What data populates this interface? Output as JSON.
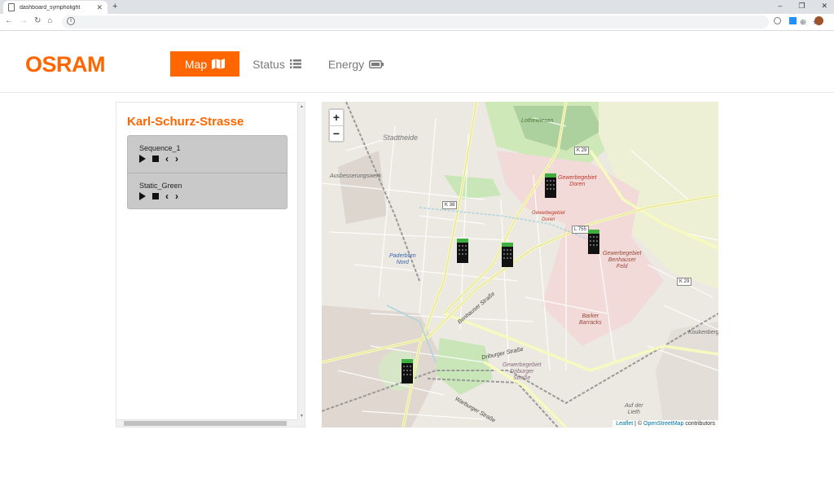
{
  "browser": {
    "tab_title": "dashboard_sympholight",
    "new_tab": "+",
    "win_min": "–",
    "win_max": "❐",
    "win_close": "✕"
  },
  "header": {
    "logo": "OSRAM",
    "menu": [
      {
        "label": "Map",
        "active": true
      },
      {
        "label": "Status",
        "active": false
      },
      {
        "label": "Energy",
        "active": false
      }
    ]
  },
  "panel": {
    "title": "Karl-Schurz-Strasse",
    "sequences": [
      {
        "name": "Sequence_1"
      },
      {
        "name": "Static_Green"
      }
    ]
  },
  "map": {
    "zoom_in": "+",
    "zoom_out": "−",
    "attribution_leaflet": "Leaflet",
    "attribution_sep": " | © ",
    "attribution_osm": "OpenStreetMap",
    "attribution_tail": " contributors",
    "labels": {
      "stadtheide": "Stadtheide",
      "lothewiesen": "Lothewiesen",
      "ausbesserungswerk": "Ausbesserungswerk",
      "gewerbegebiet_doren": "Gewerbegebiet\nDoren",
      "gewerbegebiet_doren_small": "Gewerbegebiet\nDoren",
      "gewerbegebiet_benhausen": "Gewerbegebiet\nBenhauser\nFeld",
      "paderborn_nord": "Paderborn\nNord",
      "barker": "Barker\nBarracks",
      "gewerbegebiet_driburger": "Gewerbegebiet\nDriburger\nStraße",
      "auf_der_lieth": "Auf der\nLieth",
      "benhauser_strasse": "Benhauser Straße",
      "driburger_strasse": "Driburger Straße",
      "warburger_strasse": "Warburger Straße",
      "koukenberg": "Koukenberg"
    },
    "roads": {
      "k29_top": "K 29",
      "k38": "K 38",
      "l755": "L 755",
      "k29_right": "K 29"
    }
  }
}
